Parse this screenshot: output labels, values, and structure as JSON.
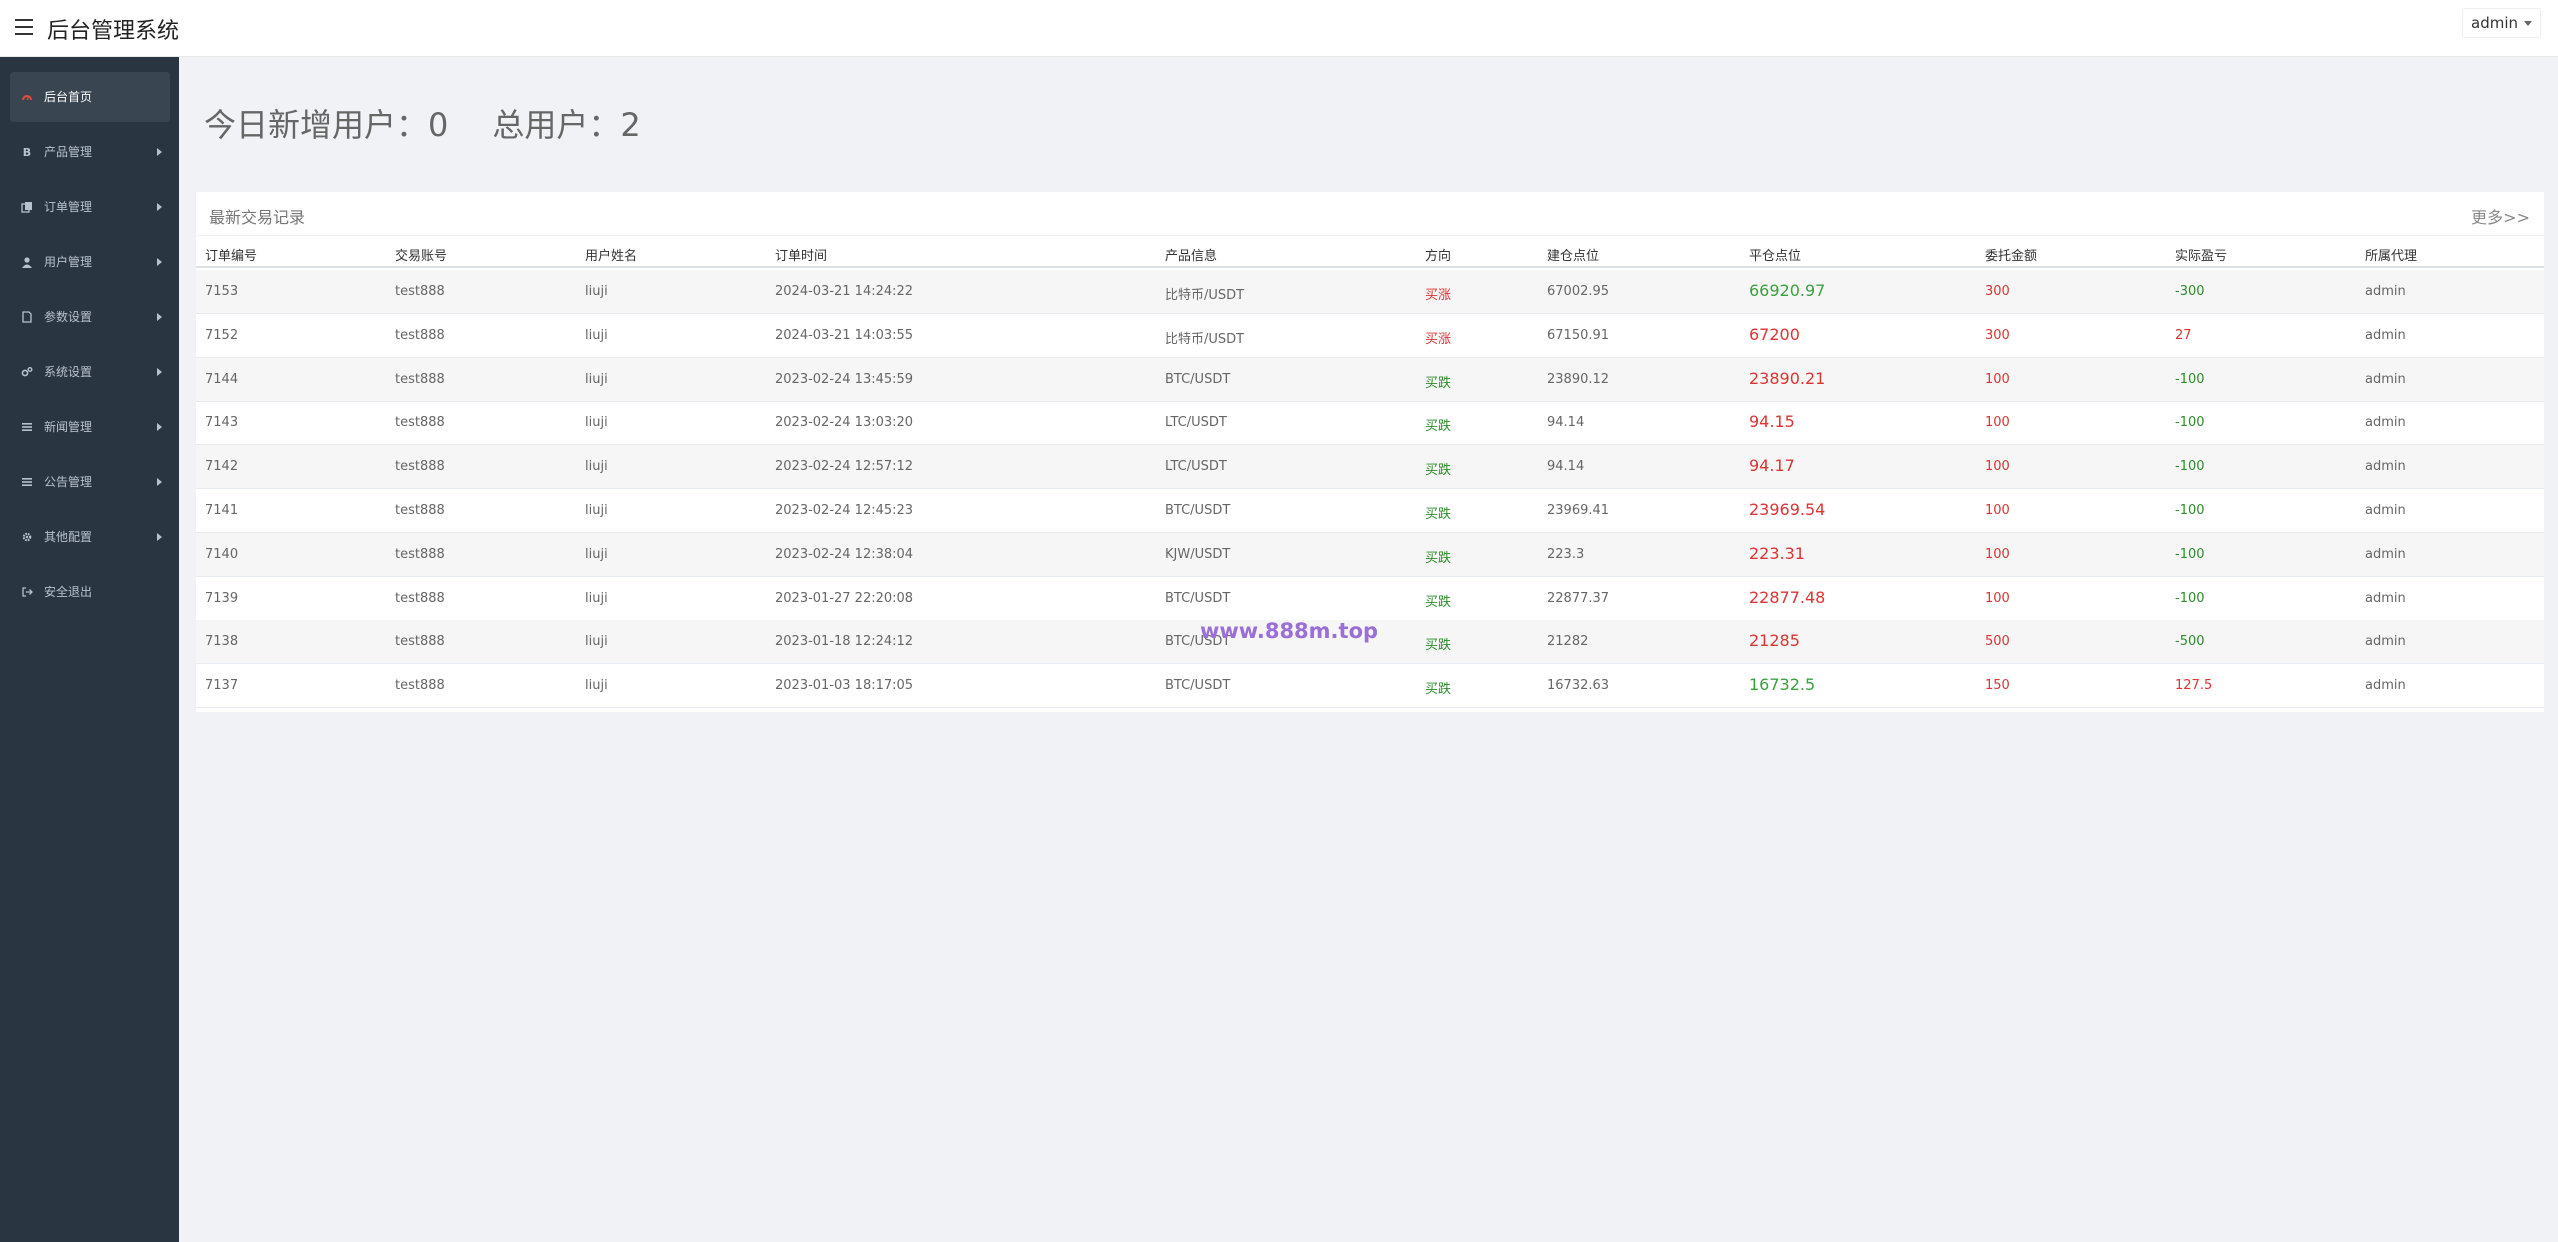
{
  "header": {
    "title": "后台管理系统",
    "user": "admin"
  },
  "sidebar": {
    "items": [
      {
        "label": "后台首页",
        "icon": "dashboard-icon",
        "active": true,
        "caret": false
      },
      {
        "label": "产品管理",
        "icon": "bitcoin-icon",
        "active": false,
        "caret": true
      },
      {
        "label": "订单管理",
        "icon": "copy-icon",
        "active": false,
        "caret": true
      },
      {
        "label": "用户管理",
        "icon": "user-icon",
        "active": false,
        "caret": true
      },
      {
        "label": "参数设置",
        "icon": "file-icon",
        "active": false,
        "caret": true
      },
      {
        "label": "系统设置",
        "icon": "gears-icon",
        "active": false,
        "caret": true
      },
      {
        "label": "新闻管理",
        "icon": "list-icon",
        "active": false,
        "caret": true
      },
      {
        "label": "公告管理",
        "icon": "list-icon",
        "active": false,
        "caret": true
      },
      {
        "label": "其他配置",
        "icon": "gear-icon",
        "active": false,
        "caret": true
      },
      {
        "label": "安全退出",
        "icon": "sign-out-icon",
        "active": false,
        "caret": false
      }
    ]
  },
  "stats": {
    "today_label": "今日新增用户：",
    "today_value": "0",
    "total_label": "总用户：",
    "total_value": "2"
  },
  "panel": {
    "title": "最新交易记录",
    "more": "更多>>"
  },
  "table": {
    "columns": [
      "订单编号",
      "交易账号",
      "用户姓名",
      "订单时间",
      "产品信息",
      "方向",
      "建仓点位",
      "平仓点位",
      "委托金额",
      "实际盈亏",
      "所属代理"
    ],
    "rows": [
      [
        "7153",
        "test888",
        "liuji",
        "2024-03-21 14:24:22",
        "比特币/USDT",
        "买涨",
        "67002.95",
        "66920.97",
        "300",
        "-300",
        "admin"
      ],
      [
        "7152",
        "test888",
        "liuji",
        "2024-03-21 14:03:55",
        "比特币/USDT",
        "买涨",
        "67150.91",
        "67200",
        "300",
        "27",
        "admin"
      ],
      [
        "7144",
        "test888",
        "liuji",
        "2023-02-24 13:45:59",
        "BTC/USDT",
        "买跌",
        "23890.12",
        "23890.21",
        "100",
        "-100",
        "admin"
      ],
      [
        "7143",
        "test888",
        "liuji",
        "2023-02-24 13:03:20",
        "LTC/USDT",
        "买跌",
        "94.14",
        "94.15",
        "100",
        "-100",
        "admin"
      ],
      [
        "7142",
        "test888",
        "liuji",
        "2023-02-24 12:57:12",
        "LTC/USDT",
        "买跌",
        "94.14",
        "94.17",
        "100",
        "-100",
        "admin"
      ],
      [
        "7141",
        "test888",
        "liuji",
        "2023-02-24 12:45:23",
        "BTC/USDT",
        "买跌",
        "23969.41",
        "23969.54",
        "100",
        "-100",
        "admin"
      ],
      [
        "7140",
        "test888",
        "liuji",
        "2023-02-24 12:38:04",
        "KJW/USDT",
        "买跌",
        "223.3",
        "223.31",
        "100",
        "-100",
        "admin"
      ],
      [
        "7139",
        "test888",
        "liuji",
        "2023-01-27 22:20:08",
        "BTC/USDT",
        "买跌",
        "22877.37",
        "22877.48",
        "100",
        "-100",
        "admin"
      ],
      [
        "7138",
        "test888",
        "liuji",
        "2023-01-18 12:24:12",
        "BTC/USDT",
        "买跌",
        "21282",
        "21285",
        "500",
        "-500",
        "admin"
      ],
      [
        "7137",
        "test888",
        "liuji",
        "2023-01-03 18:17:05",
        "BTC/USDT",
        "买跌",
        "16732.63",
        "16732.5",
        "150",
        "127.5",
        "admin"
      ]
    ]
  },
  "watermark": "www.888m.top",
  "colors": {
    "sidebar_bg": "#2a3542",
    "up": "#d33333",
    "down": "#2e8b2e"
  }
}
